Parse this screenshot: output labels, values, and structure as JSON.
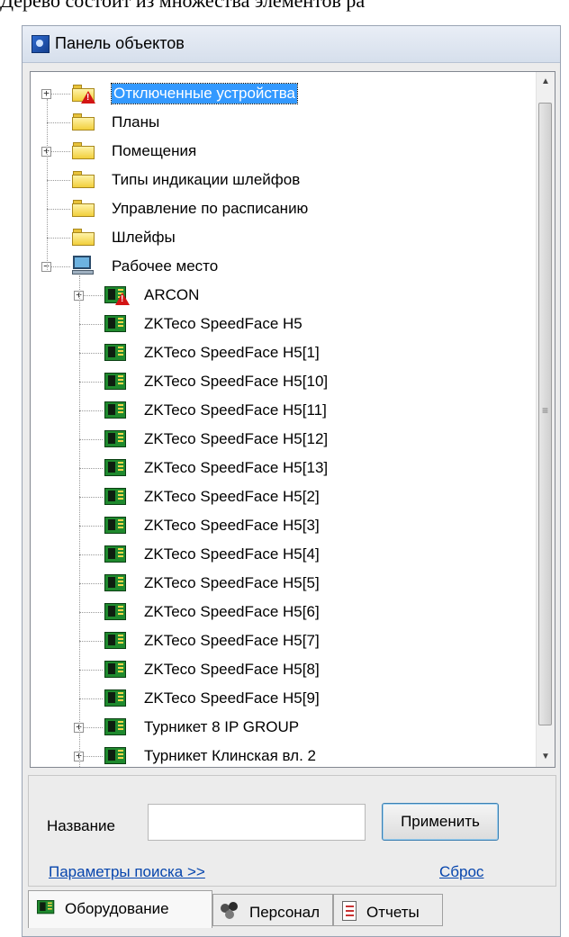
{
  "caption": "Дерево состоит из множества элементов ра",
  "window": {
    "title": "Панель объектов"
  },
  "tree": [
    {
      "label": "Отключенные устройства",
      "icon": "folder-warning-icon",
      "expander": "+",
      "selected": true
    },
    {
      "label": "Планы",
      "icon": "folder-icon"
    },
    {
      "label": "Помещения",
      "icon": "folder-icon",
      "expander": "+"
    },
    {
      "label": "Типы индикации шлейфов",
      "icon": "folder-icon"
    },
    {
      "label": "Управление по расписанию",
      "icon": "folder-icon"
    },
    {
      "label": "Шлейфы",
      "icon": "folder-icon"
    },
    {
      "label": "Рабочее место",
      "icon": "workstation-icon",
      "expander": "−"
    },
    {
      "label": "ARCON",
      "icon": "device-warning-icon",
      "expander": "+"
    },
    {
      "label": "ZKTeco SpeedFace H5",
      "icon": "device-board-icon"
    },
    {
      "label": "ZKTeco SpeedFace H5[1]",
      "icon": "device-board-icon"
    },
    {
      "label": "ZKTeco SpeedFace H5[10]",
      "icon": "device-board-icon"
    },
    {
      "label": "ZKTeco SpeedFace H5[11]",
      "icon": "device-board-icon"
    },
    {
      "label": "ZKTeco SpeedFace H5[12]",
      "icon": "device-board-icon"
    },
    {
      "label": "ZKTeco SpeedFace H5[13]",
      "icon": "device-board-icon"
    },
    {
      "label": "ZKTeco SpeedFace H5[2]",
      "icon": "device-board-icon"
    },
    {
      "label": "ZKTeco SpeedFace H5[3]",
      "icon": "device-board-icon"
    },
    {
      "label": "ZKTeco SpeedFace H5[4]",
      "icon": "device-board-icon"
    },
    {
      "label": "ZKTeco SpeedFace H5[5]",
      "icon": "device-board-icon"
    },
    {
      "label": "ZKTeco SpeedFace H5[6]",
      "icon": "device-board-icon"
    },
    {
      "label": "ZKTeco SpeedFace H5[7]",
      "icon": "device-board-icon"
    },
    {
      "label": "ZKTeco SpeedFace H5[8]",
      "icon": "device-board-icon"
    },
    {
      "label": "ZKTeco SpeedFace H5[9]",
      "icon": "device-board-icon"
    },
    {
      "label": "Турникет 8 IP GROUP",
      "icon": "device-board-icon",
      "expander": "+"
    },
    {
      "label": "Турникет Клинская вл. 2",
      "icon": "device-board-icon",
      "expander": "+"
    }
  ],
  "search": {
    "name_label": "Название",
    "name_value": "",
    "apply_label": "Применить",
    "search_params_link": "Параметры поиска >>",
    "reset_link": "Сброс"
  },
  "tabs": [
    {
      "label": "Оборудование",
      "icon": "device-board-icon",
      "active": true
    },
    {
      "label": "Персонал",
      "icon": "people-icon"
    },
    {
      "label": "Отчеты",
      "icon": "report-icon"
    }
  ],
  "colors": {
    "selection": "#3399ff",
    "link": "#0645ad",
    "warning": "#d31414",
    "board": "#1f8a2e"
  }
}
